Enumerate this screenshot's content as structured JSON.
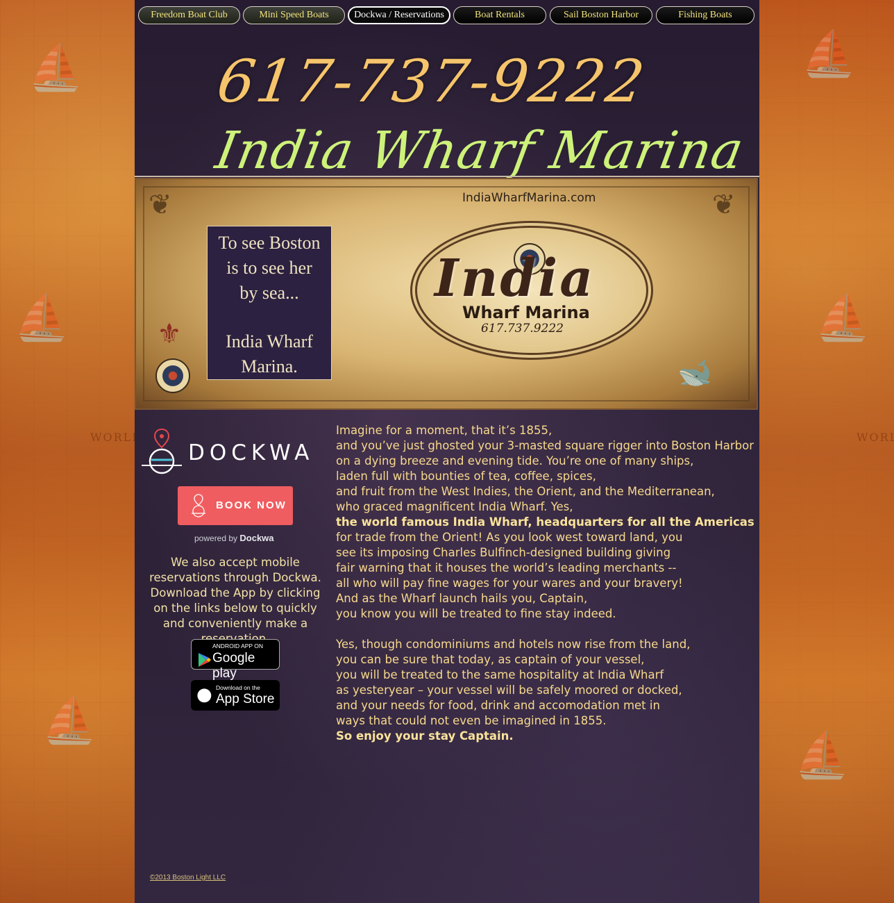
{
  "nav": {
    "items": [
      {
        "label": "Freedom Boat Club"
      },
      {
        "label": "Mini Speed Boats"
      },
      {
        "label": "Dockwa / Reservations"
      },
      {
        "label": "Boat Rentals"
      },
      {
        "label": "Sail Boston Harbor"
      },
      {
        "label": "Fishing Boats"
      }
    ],
    "active": "Dockwa / Reservations",
    "text_color": "#f1e37c"
  },
  "header": {
    "phone": "617-737-9222",
    "title": "India Wharf Marina",
    "phone_color": "#f6c56b",
    "title_color": "#cdf27a"
  },
  "banner": {
    "url": "IndiaWharfMarina.com",
    "motto_lines": [
      "To see Boston",
      "is to see her",
      "by sea...",
      "",
      "India Wharf",
      "Marina."
    ],
    "cartouche_title": "India",
    "cartouche_subtitle": "Wharf Marina",
    "cartouche_phone": "617.737.9222"
  },
  "dockwa": {
    "brand": "DOCKWA",
    "book_button": "BOOK NOW",
    "powered_prefix": "powered by",
    "powered_brand": "Dockwa",
    "button_color": "#ef5d60",
    "mobile_text": "We also accept mobile reservations through Dockwa. Download the App by clicking on the links below to quickly and conveniently make a reservation.",
    "google_badge": {
      "small": "ANDROID APP ON",
      "big": "Google play"
    },
    "apple_badge": {
      "small": "Download on the",
      "big": "App Store"
    }
  },
  "story": {
    "paragraph1": [
      {
        "text": "Imagine for a moment, that it’s 1855,",
        "bold": false
      },
      {
        "text": "and you’ve just ghosted your 3-masted square rigger into Boston Harbor",
        "bold": false
      },
      {
        "text": "on a dying breeze and evening tide.  You’re one of many ships,",
        "bold": false
      },
      {
        "text": "laden full with bounties of tea, coffee, spices,",
        "bold": false
      },
      {
        "text": "and fruit from the West Indies, the Orient, and the Mediterranean,",
        "bold": false
      },
      {
        "text": "who graced magnificent India Wharf.  Yes,",
        "bold": false
      },
      {
        "text": "the world famous India Wharf, headquarters for all the Americas",
        "bold": true
      },
      {
        "text": "for trade from the Orient!  As you look west toward land, you",
        "bold": false
      },
      {
        "text": "see its imposing Charles Bulfinch-designed building giving",
        "bold": false
      },
      {
        "text": "fair warning that it houses the world’s leading merchants --",
        "bold": false
      },
      {
        "text": "all who will pay fine wages for your wares and your bravery!",
        "bold": false
      },
      {
        "text": "And as the Wharf launch hails you, Captain,",
        "bold": false
      },
      {
        "text": "you know you will be treated to fine stay indeed.",
        "bold": false
      }
    ],
    "paragraph2": [
      {
        "text": "Yes, though condominiums and hotels now rise from the land,",
        "bold": false
      },
      {
        "text": "you can be sure that today, as captain of your vessel,",
        "bold": false
      },
      {
        "text": "you will be treated to the same hospitality at India Wharf",
        "bold": false
      },
      {
        "text": "as yesteryear – your vessel will be safely moored or docked,",
        "bold": false
      },
      {
        "text": "and your needs for food, drink and accomodation met in",
        "bold": false
      },
      {
        "text": "ways that could not even be imagined in 1855.",
        "bold": false
      },
      {
        "text": "So enjoy your stay Captain.",
        "bold": true
      }
    ],
    "text_color": "#f7d98c"
  },
  "footer": {
    "copyright": "©2013 Boston Light LLC"
  },
  "background": {
    "side_word": "WORLD",
    "side_color": "#c8661f",
    "column_color": "#2b2035"
  }
}
